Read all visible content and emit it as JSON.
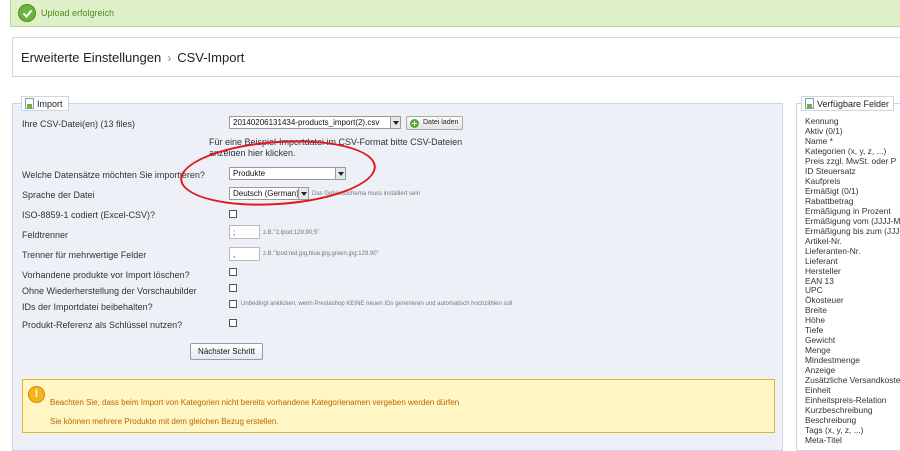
{
  "success": {
    "message": "Upload erfolgreich"
  },
  "breadcrumb": {
    "parent": "Erweiterte Einstellungen",
    "separator": "›",
    "current": "CSV-Import"
  },
  "import_panel": {
    "legend": "Import",
    "file": {
      "label": "Ihre CSV-Datei(en) (13 files)",
      "selected": "20140206131434-products_import(2).csv",
      "load_button": "Datei laden"
    },
    "example_note": "Für eine Beispiel-Importdatei im CSV-Format bitte CSV-Dateien anzeigen hier klicken.",
    "entity": {
      "label": "Welche Datensätze möchten Sie importieren?",
      "selected": "Produkte"
    },
    "language": {
      "label": "Sprache der Datei",
      "selected": "Deutsch (German)",
      "hint": "Das Gebietsschema muss installiert sein"
    },
    "iso": {
      "label": "ISO-8859-1 codiert (Excel-CSV)?"
    },
    "separator": {
      "label": "Feldtrenner",
      "value": ";",
      "hint": "z.B.\"1;Ipod;129.90;5\""
    },
    "multi_separator": {
      "label": "Trenner für mehrwertige Felder",
      "value": ",",
      "hint": "z.B.\"Ipod;red.jpg,blue.jpg,green.jpg;129.90\""
    },
    "truncate": {
      "label": "Vorhandene produkte vor Import löschen?"
    },
    "regenerate": {
      "label": "Ohne Wiederherstellung der Vorschaubilder"
    },
    "force_ids": {
      "label": "IDs der Importdatei beibehalten?",
      "hint": "Unbedingt anklicken, wenn Prestashop KEINE neuen IDs generieren und automatisch hochzählen soll"
    },
    "match_ref": {
      "label": "Produkt-Referenz als Schlüssel nutzen?"
    },
    "next_button": "Nächster Schritt",
    "warning": {
      "line1": "Beachten Sie, dass beim Import von Kategorien nicht bereits vorhandene Kategorienamen vergeben werden dürfen",
      "line2": "Sie können mehrere Produkte mit dem gleichen Bezug erstellen."
    }
  },
  "fields_panel": {
    "legend": "Verfügbare Felder",
    "fields": [
      "Kennung",
      "Aktiv (0/1)",
      "Name *",
      "Kategorien (x, y, z, ...)",
      "Preis zzgl. MwSt. oder P",
      "ID Steuersatz",
      "Kaufpreis",
      "Ermäßigt (0/1)",
      "Rabattbetrag",
      "Ermäßigung in Prozent",
      "Ermäßigung vom (JJJJ-M",
      "Ermäßigung bis zum (JJJ",
      "Artikel-Nr.",
      "Lieferanten-Nr.",
      "Lieferant",
      "Hersteller",
      "EAN 13",
      "UPC",
      "Ökosteuer",
      "Breite",
      "Höhe",
      "Tiefe",
      "Gewicht",
      "Menge",
      "Mindestmenge",
      "Anzeige",
      "Zusätzliche Versandkoste",
      "Einheit",
      "Einheitspreis-Relation",
      "Kurzbeschreibung",
      "Beschreibung",
      "Tags (x, y, z, ...)",
      "Meta-Titel"
    ]
  },
  "colors": {
    "success_bg": "#dff0c8",
    "success_text": "#4a8b1f",
    "panel_bg": "#eef0f7",
    "warning_bg": "#fff6c4",
    "warning_text": "#b86700",
    "annotation_red": "#e1161b"
  }
}
